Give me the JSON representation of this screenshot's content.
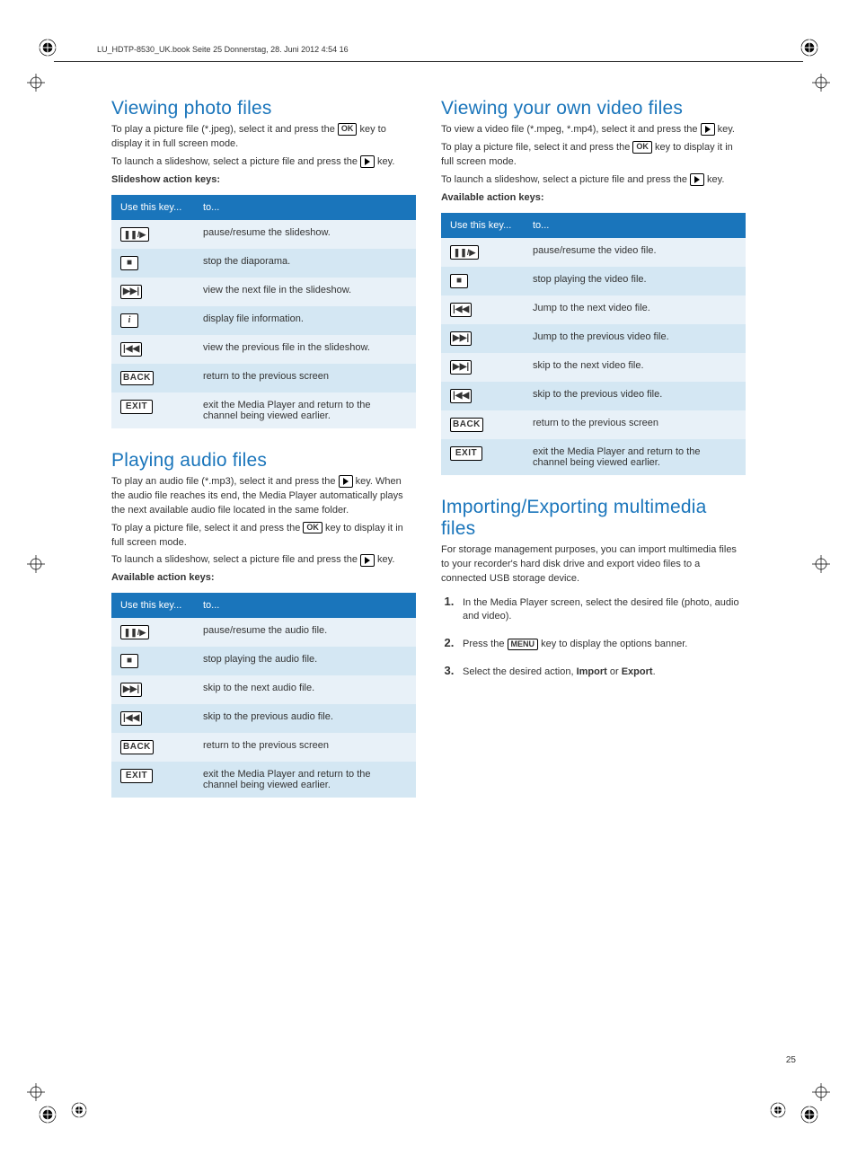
{
  "header": "LU_HDTP-8530_UK.book  Seite 25  Donnerstag, 28. Juni 2012  4:54 16",
  "page_number": "25",
  "keys": {
    "ok": "OK",
    "back": "BACK",
    "exit": "EXIT",
    "menu": "MENU"
  },
  "col1": {
    "s1": {
      "title": "Viewing photo files",
      "p1a": "To play a picture file (*.jpeg), select it and press the ",
      "p1b": " key to display it in full screen mode.",
      "p2a": "To launch a slideshow, select a picture file and press the ",
      "p2b": " key.",
      "p3": "Slideshow action keys:",
      "th1": "Use this key...",
      "th2": "to...",
      "rows": [
        {
          "icon": "pauseplay",
          "text": "pause/resume the slideshow."
        },
        {
          "icon": "stop",
          "text": "stop the diaporama."
        },
        {
          "icon": "next",
          "text": "view the next file in the slideshow."
        },
        {
          "icon": "info",
          "text": "display file information."
        },
        {
          "icon": "prev",
          "text": "view the previous file in the slideshow."
        },
        {
          "icon": "back",
          "text": "return to the previous screen"
        },
        {
          "icon": "exit",
          "text": "exit the Media Player and return to the channel being viewed earlier."
        }
      ]
    },
    "s2": {
      "title": "Playing audio files",
      "p1a": "To play an audio file (*.mp3), select it and press the ",
      "p1b": " key. When the audio file reaches its end, the Media Player automatically plays the next available audio file located in the same folder.",
      "p2a": "To play a picture file, select it and press the ",
      "p2b": " key to display it in full screen mode.",
      "p3a": "To launch a slideshow, select a picture file and press the ",
      "p3b": " key.",
      "p4": "Available action keys:",
      "th1": "Use this key...",
      "th2": "to...",
      "rows": [
        {
          "icon": "pauseplay",
          "text": "pause/resume the audio file."
        },
        {
          "icon": "stop",
          "text": "stop playing the audio file."
        },
        {
          "icon": "next",
          "text": "skip to the next audio file."
        },
        {
          "icon": "prev",
          "text": "skip to the previous audio file."
        },
        {
          "icon": "back",
          "text": "return to the previous screen"
        },
        {
          "icon": "exit",
          "text": "exit the Media Player and return to the channel being viewed earlier."
        }
      ]
    }
  },
  "col2": {
    "s1": {
      "title": "Viewing your own video files",
      "p1a": "To view a video file (*.mpeg, *.mp4), select it and press the ",
      "p1b": " key.",
      "p2a": "To play a picture file, select it and press the ",
      "p2b": " key to display it in full screen mode.",
      "p3a": "To launch a slideshow, select a picture file and press the ",
      "p3b": " key.",
      "p4": "Available action keys:",
      "th1": "Use this key...",
      "th2": "to...",
      "rows": [
        {
          "icon": "pauseplay",
          "text": "pause/resume the video file."
        },
        {
          "icon": "stop",
          "text": "stop playing the video file."
        },
        {
          "icon": "rew",
          "text": "Jump to the next video file."
        },
        {
          "icon": "ff",
          "text": "Jump to the previous video file."
        },
        {
          "icon": "next",
          "text": "skip to the next video file."
        },
        {
          "icon": "prev",
          "text": "skip to the previous video file."
        },
        {
          "icon": "back",
          "text": "return to the previous screen"
        },
        {
          "icon": "exit",
          "text": "exit the Media Player and return to the channel being viewed earlier."
        }
      ]
    },
    "s2": {
      "title": "Importing/Exporting multimedia files",
      "p1": "For storage management purposes, you can import multimedia files to your recorder's hard disk drive and export video files to a connected USB storage device.",
      "li1": "In the Media Player screen, select the desired file (photo, audio and video).",
      "li2a": "Press the ",
      "li2b": " key to display the options banner.",
      "li3a": "Select the desired action, ",
      "li3b": "Import",
      "li3c": " or ",
      "li3d": "Export",
      "li3e": "."
    }
  }
}
